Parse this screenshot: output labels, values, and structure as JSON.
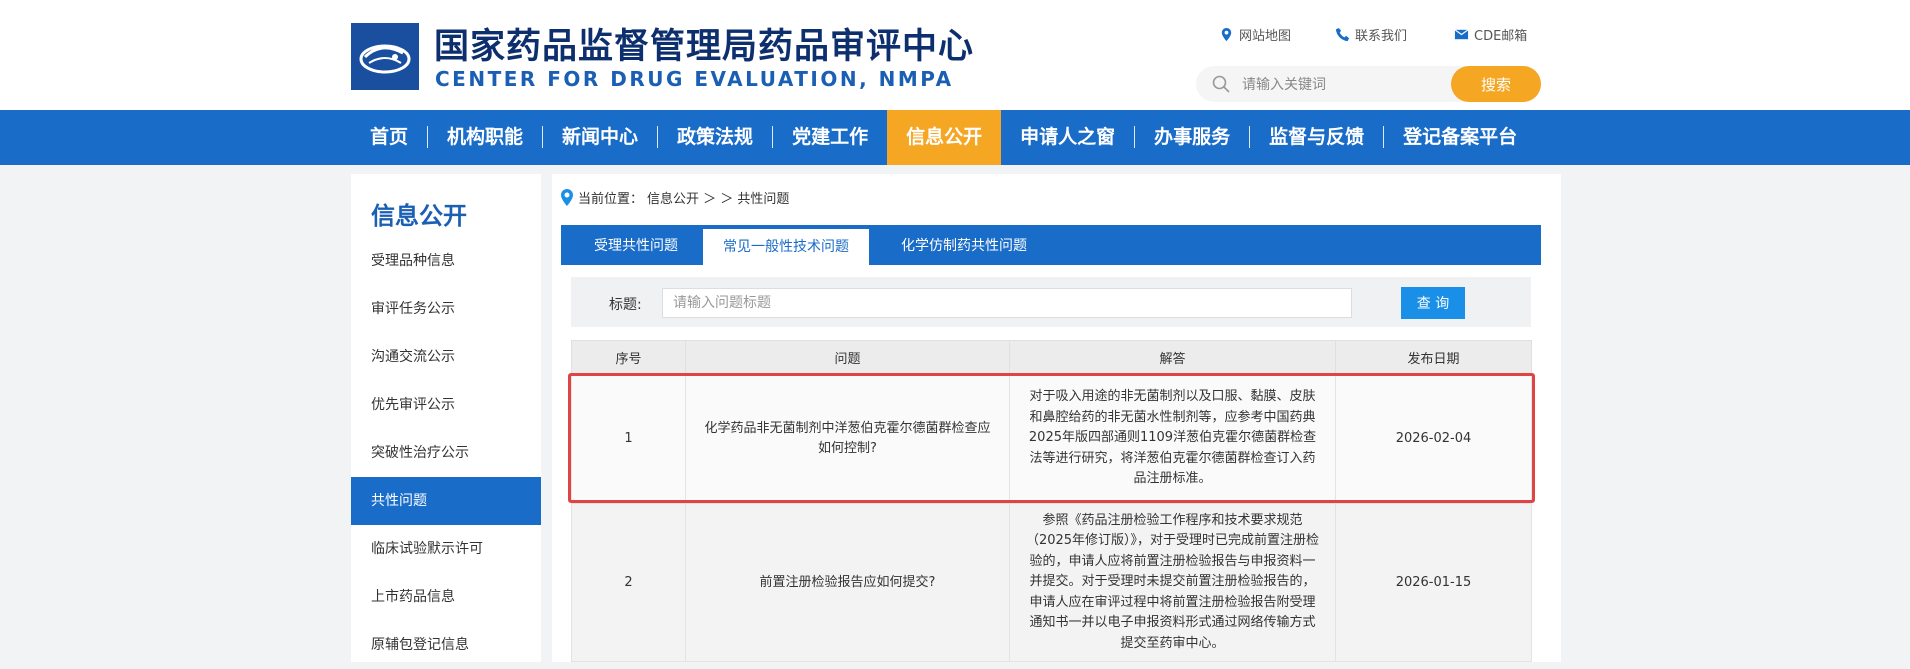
{
  "header": {
    "title_cn": "国家药品监督管理局药品审评中心",
    "title_en": "CENTER FOR DRUG EVALUATION, NMPA",
    "links": [
      {
        "label": "网站地图",
        "icon": "location-pin-icon"
      },
      {
        "label": "联系我们",
        "icon": "phone-icon"
      },
      {
        "label": "CDE邮箱",
        "icon": "mail-icon"
      }
    ],
    "search_placeholder": "请输入关键词",
    "search_button": "搜索"
  },
  "nav": {
    "items": [
      "首页",
      "机构职能",
      "新闻中心",
      "政策法规",
      "党建工作",
      "信息公开",
      "申请人之窗",
      "办事服务",
      "监督与反馈",
      "登记备案平台"
    ],
    "active": "信息公开"
  },
  "sidebar": {
    "title": "信息公开",
    "items": [
      "受理品种信息",
      "审评任务公示",
      "沟通交流公示",
      "优先审评公示",
      "突破性治疗公示",
      "共性问题",
      "临床试验默示许可",
      "上市药品信息",
      "原辅包登记信息"
    ],
    "active": "共性问题"
  },
  "breadcrumb": {
    "prefix": "当前位置：",
    "path": "信息公开 ＞ ＞ 共性问题"
  },
  "tabs": {
    "items": [
      "受理共性问题",
      "常见一般性技术问题",
      "化学仿制药共性问题"
    ],
    "active": "常见一般性技术问题"
  },
  "filter": {
    "label": "标题:",
    "placeholder": "请输入问题标题",
    "button": "查 询"
  },
  "table": {
    "headers": [
      "序号",
      "问题",
      "解答",
      "发布日期"
    ],
    "rows": [
      {
        "no": "1",
        "question": "化学药品非无菌制剂中洋葱伯克霍尔德菌群检查应如何控制?",
        "answer": "对于吸入用途的非无菌制剂以及口服、黏膜、皮肤和鼻腔给药的非无菌水性制剂等，应参考中国药典2025年版四部通则1109洋葱伯克霍尔德菌群检查法等进行研究，将洋葱伯克霍尔德菌群检查订入药品注册标准。",
        "date": "2026-02-04"
      },
      {
        "no": "2",
        "question": "前置注册检验报告应如何提交?",
        "answer": "参照《药品注册检验工作程序和技术要求规范（2025年修订版）》，对于受理时已完成前置注册检验的，申请人应将前置注册检验报告与申报资料一并提交。对于受理时未提交前置注册检验报告的，申请人应在审评过程中将前置注册检验报告附受理通知书一并以电子申报资料形式通过网络传输方式提交至药审中心。",
        "date": "2026-01-15"
      }
    ]
  },
  "colors": {
    "nav_blue": "#1a6cc9",
    "accent_orange": "#f5a623",
    "highlight_red": "#e04545"
  }
}
